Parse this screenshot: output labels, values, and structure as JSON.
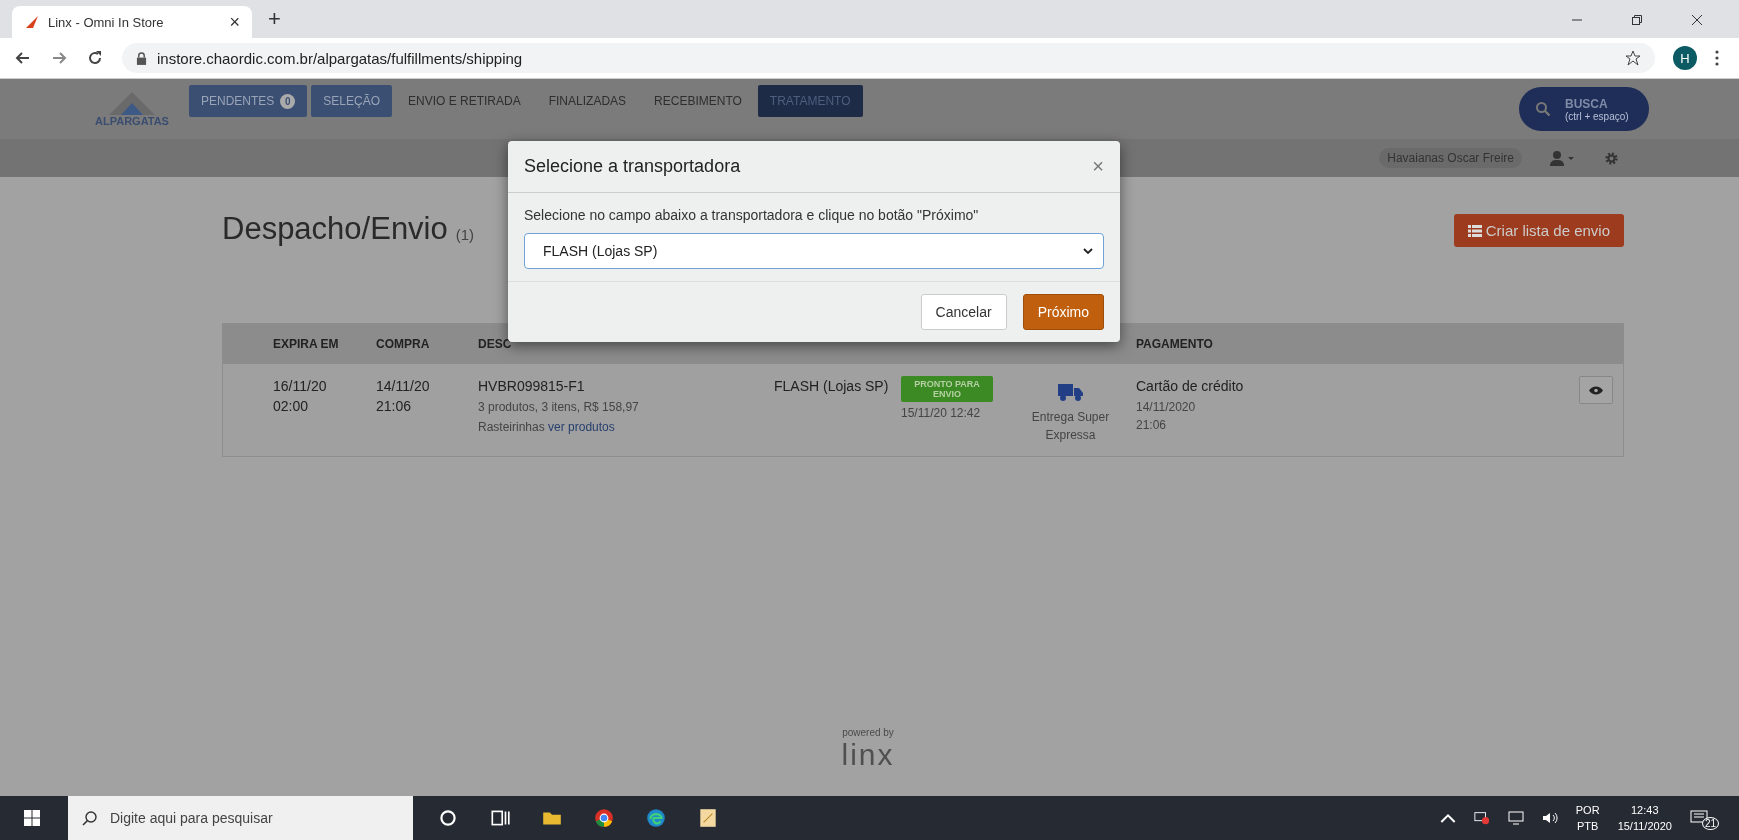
{
  "browser": {
    "tab_title": "Linx - Omni In Store",
    "tab_close": "×",
    "new_tab": "+",
    "url": "instore.chaordic.com.br/alpargatas/fulfillments/shipping",
    "avatar": "H"
  },
  "header": {
    "logo": "ALPARGATAS",
    "nav": [
      {
        "label": "PENDENTES",
        "badge": "0",
        "kind": "blue"
      },
      {
        "label": "SELEÇÃO",
        "kind": "blue"
      },
      {
        "label": "ENVIO E RETIRADA",
        "kind": "plain"
      },
      {
        "label": "FINALIZADAS",
        "kind": "plain"
      },
      {
        "label": "RECEBIMENTO",
        "kind": "plain"
      },
      {
        "label": "TRATAMENTO",
        "kind": "dark"
      }
    ],
    "search": {
      "label": "BUSCA",
      "hint": "(ctrl + espaço)"
    },
    "store": "Havaianas Oscar Freire"
  },
  "page": {
    "title": "Despacho/Envio",
    "count": "(1)",
    "create_button": "Criar lista de envio"
  },
  "table": {
    "columns": [
      {
        "label": "EXPIRA EM"
      },
      {
        "label": "COMPRA"
      },
      {
        "label": "DESC"
      },
      {},
      {},
      {},
      {
        "label": "PAGAMENTO"
      }
    ],
    "rows": [
      {
        "expires": [
          "16/11/20",
          "02:00"
        ],
        "purchase": [
          "14/11/20",
          "21:06"
        ],
        "order": "HVBR099815-F1",
        "summary": "3 produtos, 3 itens, R$ 158,97",
        "product": "Rasteirinhas",
        "product_link": "ver produtos",
        "carrier": "FLASH (Lojas SP)",
        "status": "PRONTO PARA ENVIO",
        "status_time": "15/11/20 12:42",
        "delivery": "Entrega Super Expressa",
        "payment": "Cartão de crédito",
        "payment_time": [
          "14/11/2020",
          "21:06"
        ]
      }
    ]
  },
  "footer": {
    "powered": "powered by",
    "brand": "linx"
  },
  "modal": {
    "title": "Selecione a transportadora",
    "close": "×",
    "text": "Selecione no campo abaixo a transportadora e clique no botão \"Próximo\"",
    "select": "FLASH (Lojas SP)",
    "buttons": [
      {
        "label": "Cancelar",
        "kind": "secondary"
      },
      {
        "label": "Próximo",
        "kind": "primary"
      }
    ]
  },
  "taskbar": {
    "search_placeholder": "Digite aqui para pesquisar",
    "lang": [
      "POR",
      "PTB"
    ],
    "time": "12:43",
    "date": "15/11/2020",
    "notifications": "21"
  }
}
